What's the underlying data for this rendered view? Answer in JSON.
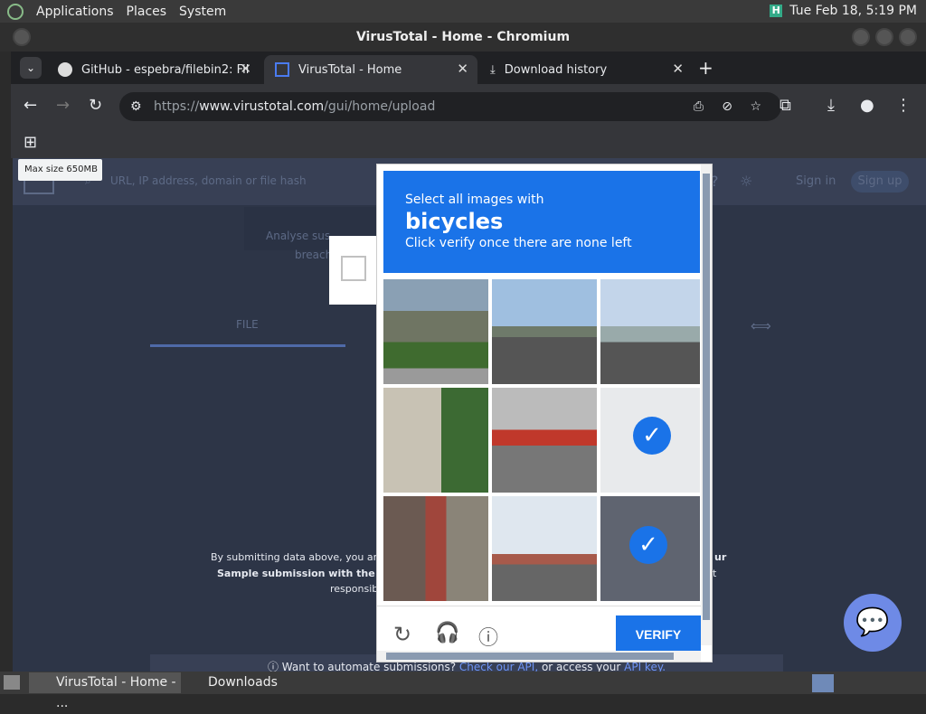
{
  "os_panel": {
    "applications": "Applications",
    "places": "Places",
    "system": "System",
    "clock": "Tue Feb 18,  5:19 PM"
  },
  "window": {
    "title": "VirusTotal - Home - Chromium"
  },
  "tabs": [
    {
      "label": "GitHub - espebra/filebin2: Fil"
    },
    {
      "label": "VirusTotal - Home"
    },
    {
      "label": "Download history"
    }
  ],
  "address": {
    "prefix": "https://",
    "host": "www.virustotal.com",
    "path": "/gui/home/upload"
  },
  "tooltip": {
    "text": "Max size 650MB"
  },
  "page": {
    "search_placeholder": "URL, IP address, domain or file hash",
    "sign_in": "Sign in",
    "sign_up": "Sign up",
    "intro_line1": "Analyse sus",
    "intro_line2": "breach",
    "tab_file": "FILE",
    "terms_line1": "By submitting data above, you are ag",
    "terms_line1_end": "ur",
    "terms_line2": "Sample submission with the secu",
    "terms_line2_end": "t",
    "terms_line3": "responsib",
    "automate_text": "Want to automate submissions?",
    "automate_link1": "Check our API,",
    "automate_mid": "or access your",
    "automate_link2": "API key."
  },
  "captcha": {
    "select_text": "Select all images with",
    "target": "bicycles",
    "instruction": "Click verify once there are none left",
    "verify_label": "VERIFY",
    "tiles": [
      {
        "name": "tile-building",
        "selected": false
      },
      {
        "name": "tile-road",
        "selected": false
      },
      {
        "name": "tile-bridge",
        "selected": false
      },
      {
        "name": "tile-alley",
        "selected": false
      },
      {
        "name": "tile-street-shop",
        "selected": false
      },
      {
        "name": "tile-bicycle",
        "selected": true
      },
      {
        "name": "tile-stairs",
        "selected": false
      },
      {
        "name": "tile-highway",
        "selected": false
      },
      {
        "name": "tile-dark-bicycle",
        "selected": true
      }
    ]
  },
  "taskbar": {
    "item1": "VirusTotal - Home - ...",
    "item2": "Downloads"
  }
}
